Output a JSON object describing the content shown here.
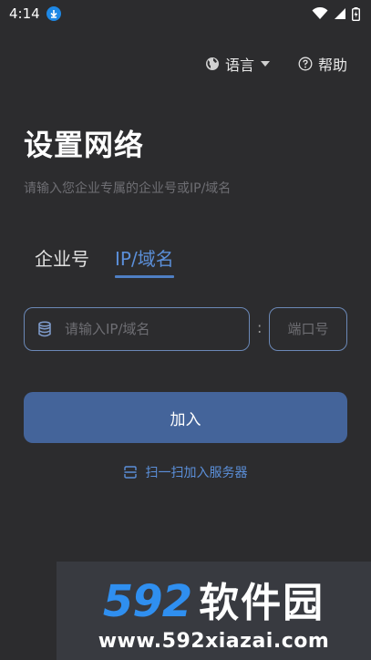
{
  "status_bar": {
    "time": "4:14",
    "icons": [
      "download-badge-icon",
      "wifi-icon",
      "signal-icon",
      "battery-icon"
    ]
  },
  "topbar": {
    "language_label": "语言",
    "help_label": "帮助"
  },
  "title": "设置网络",
  "subtitle": "请输入您企业专属的企业号或IP/域名",
  "tabs": [
    {
      "label": "企业号",
      "active": false
    },
    {
      "label": "IP/域名",
      "active": true
    }
  ],
  "form": {
    "host_placeholder": "请输入IP/域名",
    "separator": ":",
    "port_placeholder": "端口号"
  },
  "join_button": "加入",
  "scan_link": "扫一扫加入服务器",
  "watermark": {
    "brand_number": "592",
    "brand_text": "软件园",
    "url": "www.592xiazai.com"
  },
  "colors": {
    "background": "#2c2c2e",
    "accent": "#5b8fd9",
    "button": "#44649a",
    "input_border": "#6b88b6"
  }
}
